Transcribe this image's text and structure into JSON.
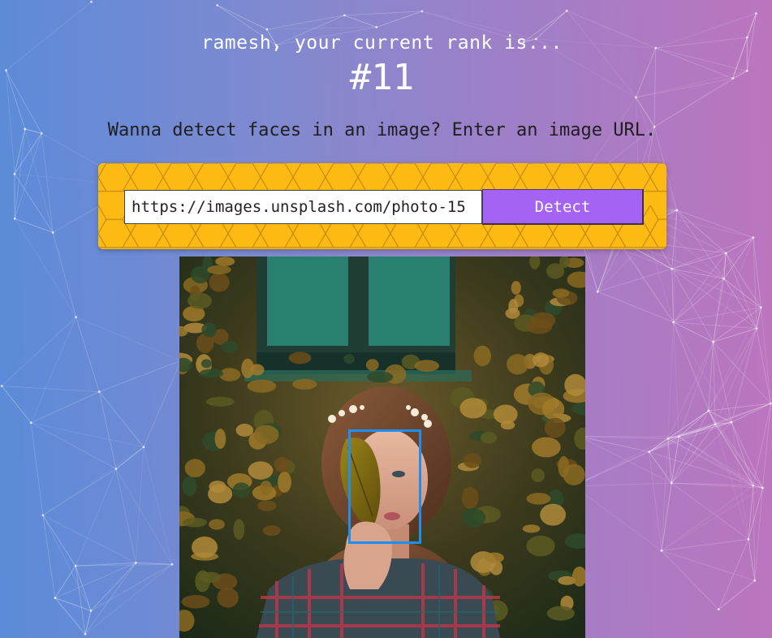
{
  "user": {
    "rank_heading": "ramesh, your current rank is...",
    "rank_value": "#11"
  },
  "prompt": {
    "text": "Wanna detect faces in an image? Enter an image URL."
  },
  "form": {
    "url_value": "https://images.unsplash.com/photo-15",
    "detect_label": "Detect"
  },
  "colors": {
    "panel": "#fcba12",
    "button": "#a463f2",
    "face_box": "#1f8ef1"
  },
  "image": {
    "faces_detected": 1
  }
}
